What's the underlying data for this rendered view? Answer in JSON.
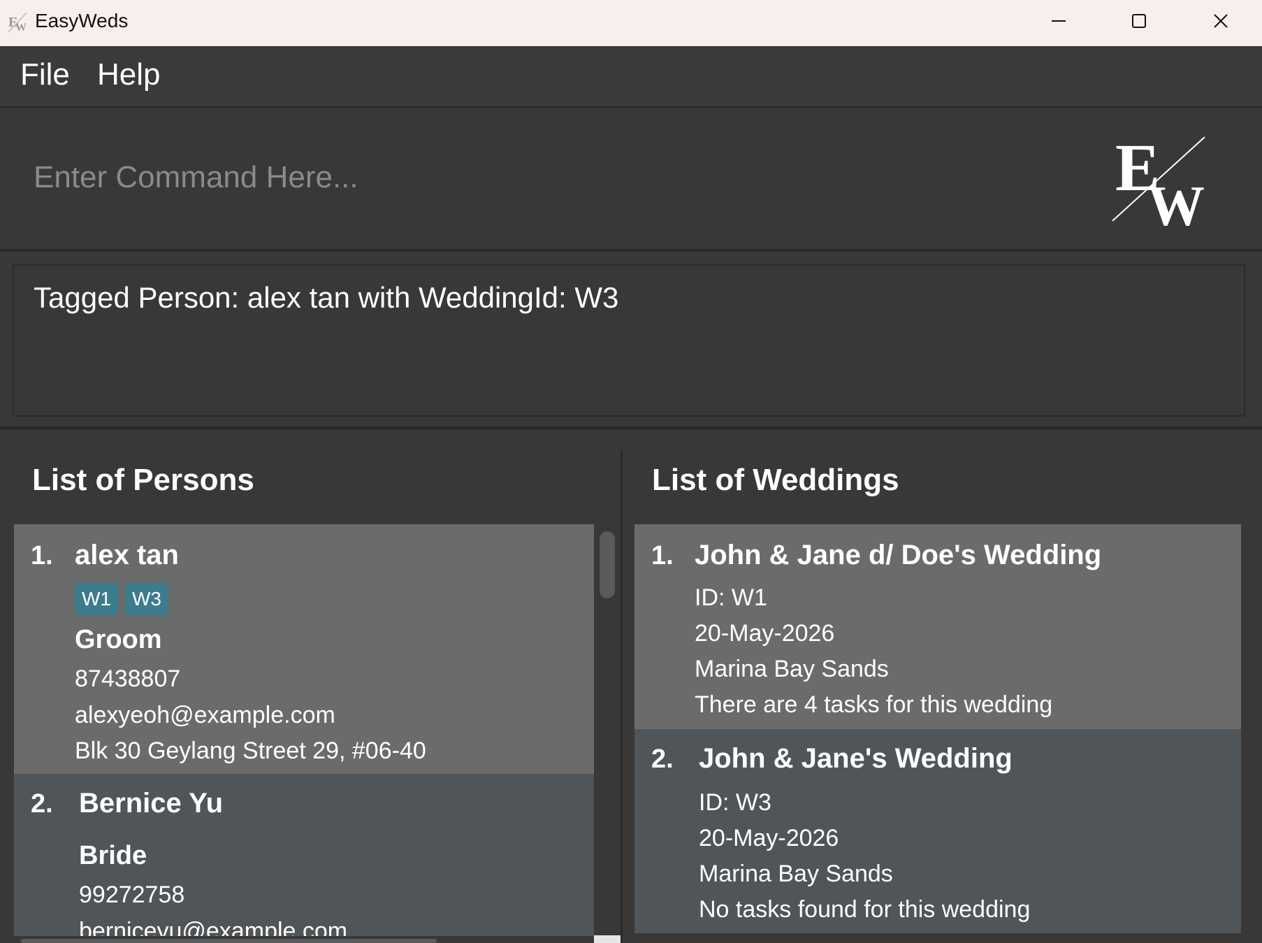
{
  "window": {
    "title": "EasyWeds",
    "icon": "easyweds-app-icon"
  },
  "menu": {
    "file": "File",
    "help": "Help"
  },
  "command": {
    "placeholder": "Enter Command Here...",
    "value": ""
  },
  "logo": {
    "name": "easyweds-logo",
    "letters": "EW"
  },
  "result": {
    "text": "Tagged Person: alex tan with WeddingId: W3"
  },
  "persons_panel": {
    "title": "List of Persons",
    "items": [
      {
        "index": "1.",
        "name": "alex tan",
        "tags": [
          "W1",
          "W3"
        ],
        "role": "Groom",
        "phone": "87438807",
        "email": "alexyeoh@example.com",
        "address": "Blk 30 Geylang Street 29, #06-40"
      },
      {
        "index": "2.",
        "name": "Bernice Yu",
        "tags": [],
        "role": "Bride",
        "phone": "99272758",
        "email": "berniceyu@example.com"
      }
    ]
  },
  "weddings_panel": {
    "title": "List of Weddings",
    "items": [
      {
        "index": "1.",
        "name": "John & Jane d/ Doe's Wedding",
        "id": "ID: W1",
        "date": "20-May-2026",
        "venue": "Marina Bay Sands",
        "tasks": "There are 4 tasks for this wedding"
      },
      {
        "index": "2.",
        "name": "John & Jane's Wedding",
        "id": "ID: W3",
        "date": "20-May-2026",
        "venue": "Marina Bay Sands",
        "tasks": "No tasks found for this wedding"
      }
    ]
  },
  "colors": {
    "background": "#383838",
    "selected_card": "#6b6b6b",
    "card": "#4f5559",
    "tag": "#3d7b8e",
    "titlebar": "#f8efed"
  }
}
